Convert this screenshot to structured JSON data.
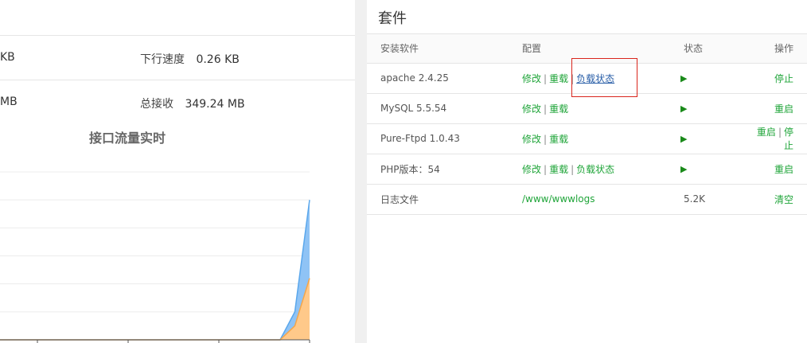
{
  "stats": {
    "row1_left_value": "KB",
    "download_label": "下行速度",
    "download_value": "0.26 KB",
    "row2_left_value": "MB",
    "total_rx_label": "总接收",
    "total_rx_value": "349.24 MB"
  },
  "chart_title": "接口流量实时",
  "chart_data": {
    "type": "area",
    "title": "接口流量实时",
    "series": [
      {
        "name": "",
        "color": "#8fc3f5",
        "values": [
          0,
          0,
          0,
          0,
          0,
          0,
          0,
          0,
          0,
          0,
          0,
          0,
          0,
          0,
          0,
          0,
          0,
          0,
          0,
          0,
          0.5,
          2.5
        ]
      },
      {
        "name": "",
        "color": "#ffc98a",
        "values": [
          0,
          0,
          0,
          0,
          0,
          0,
          0,
          0,
          0,
          0,
          0,
          0,
          0,
          0,
          0,
          0,
          0,
          0,
          0,
          0,
          0.25,
          1.1
        ]
      }
    ],
    "ylim": [
      0,
      3
    ],
    "grid": true
  },
  "suite": {
    "title": "套件",
    "headers": {
      "software": "安装软件",
      "config": "配置",
      "status": "状态",
      "action": "操作"
    },
    "rows": [
      {
        "name": "apache 2.4.25",
        "modify": "修改",
        "reload": "重载",
        "load_status": "负载状态",
        "status_icon": "play-icon",
        "actions": [
          "停止"
        ]
      },
      {
        "name": "MySQL 5.5.54",
        "modify": "修改",
        "reload": "重载",
        "status_icon": "play-icon",
        "actions": [
          "重启"
        ]
      },
      {
        "name": "Pure-Ftpd 1.0.43",
        "modify": "修改",
        "reload": "重载",
        "status_icon": "play-icon",
        "actions": [
          "重启",
          "停止"
        ]
      },
      {
        "name": "PHP版本：54",
        "modify": "修改",
        "reload": "重载",
        "load_status": "负载状态",
        "status_icon": "play-icon",
        "actions": [
          "重启"
        ]
      },
      {
        "name": "日志文件",
        "path": "/www/wwwlogs",
        "size": "5.2K",
        "actions": [
          "清空"
        ]
      }
    ]
  }
}
